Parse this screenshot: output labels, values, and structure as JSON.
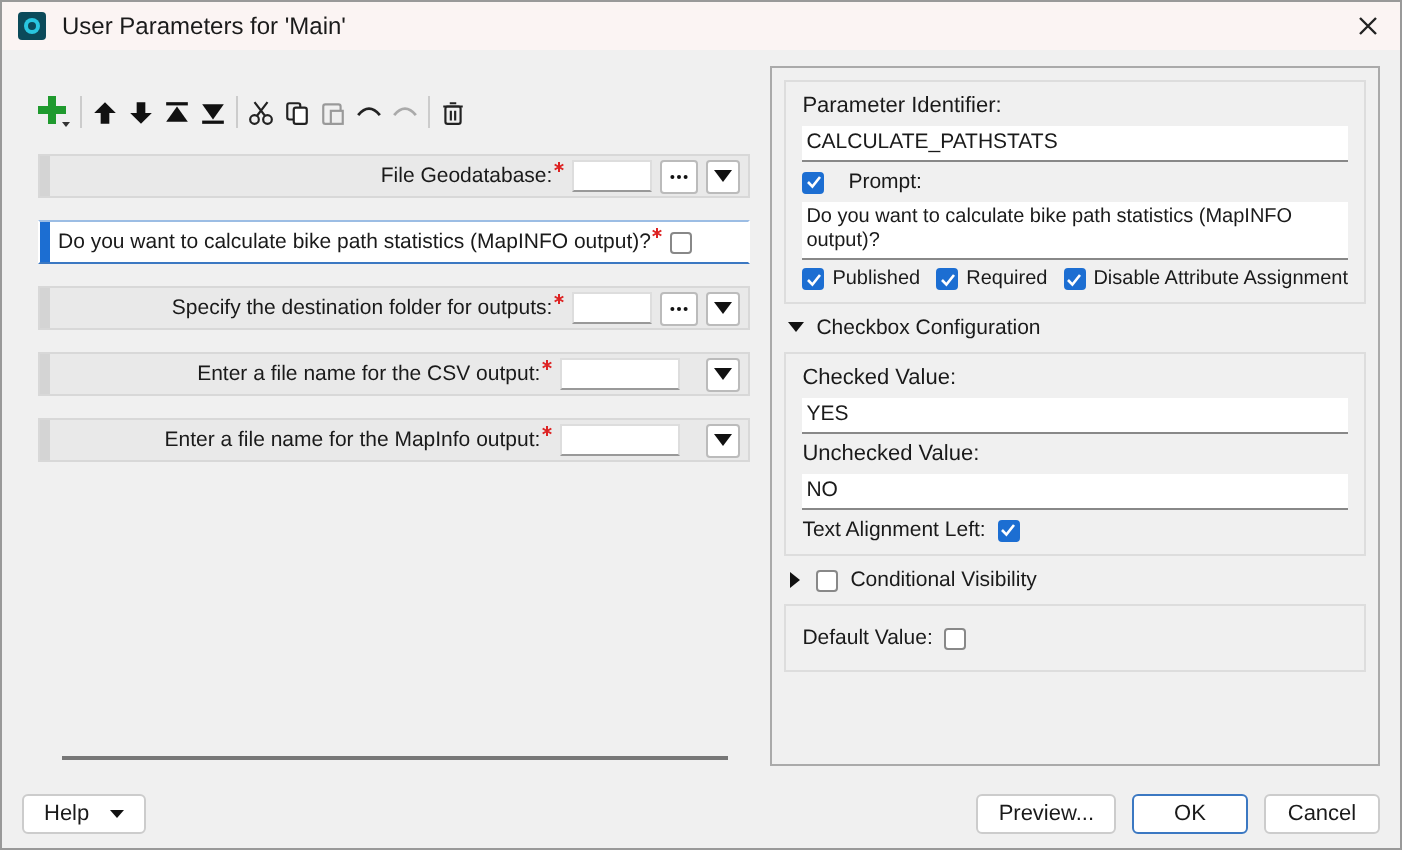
{
  "window": {
    "title": "User Parameters for 'Main'"
  },
  "parameters": [
    {
      "kind": "file",
      "label": "File Geodatabase:",
      "required": true,
      "selected": false
    },
    {
      "kind": "checkbox",
      "label": "Do you want to calculate bike path statistics (MapINFO output)?",
      "required": true,
      "selected": true,
      "checked": false
    },
    {
      "kind": "file",
      "label": "Specify the destination folder for outputs:",
      "required": true,
      "selected": false
    },
    {
      "kind": "text",
      "label": "Enter a file name for the CSV output:",
      "required": true,
      "selected": false
    },
    {
      "kind": "text",
      "label": "Enter a file name for the MapInfo output:",
      "required": true,
      "selected": false
    }
  ],
  "properties": {
    "identifier": {
      "label": "Parameter Identifier:",
      "value": "CALCULATE_PATHSTATS"
    },
    "prompt": {
      "label": "Prompt:",
      "checked": true,
      "value": "Do you want to calculate bike path statistics (MapINFO output)?"
    },
    "flags": [
      {
        "label": "Published",
        "checked": true
      },
      {
        "label": "Required",
        "checked": true
      },
      {
        "label": "Disable Attribute Assignment",
        "checked": true
      }
    ],
    "checkbox_configuration": {
      "title": "Checkbox Configuration",
      "expanded": true,
      "checked_value": {
        "label": "Checked Value:",
        "value": "YES"
      },
      "unchecked_value": {
        "label": "Unchecked Value:",
        "value": "NO"
      },
      "text_alignment_left": {
        "label": "Text Alignment Left:",
        "checked": true
      }
    },
    "conditional_visibility": {
      "title": "Conditional Visibility",
      "expanded": false,
      "checked": false
    },
    "default_value": {
      "label": "Default Value:",
      "checked": false
    }
  },
  "buttons": [
    {
      "label": "Help",
      "kind": "menu"
    },
    {
      "label": "Preview...",
      "kind": "plain"
    },
    {
      "label": "OK",
      "kind": "default"
    },
    {
      "label": "Cancel",
      "kind": "plain"
    }
  ]
}
